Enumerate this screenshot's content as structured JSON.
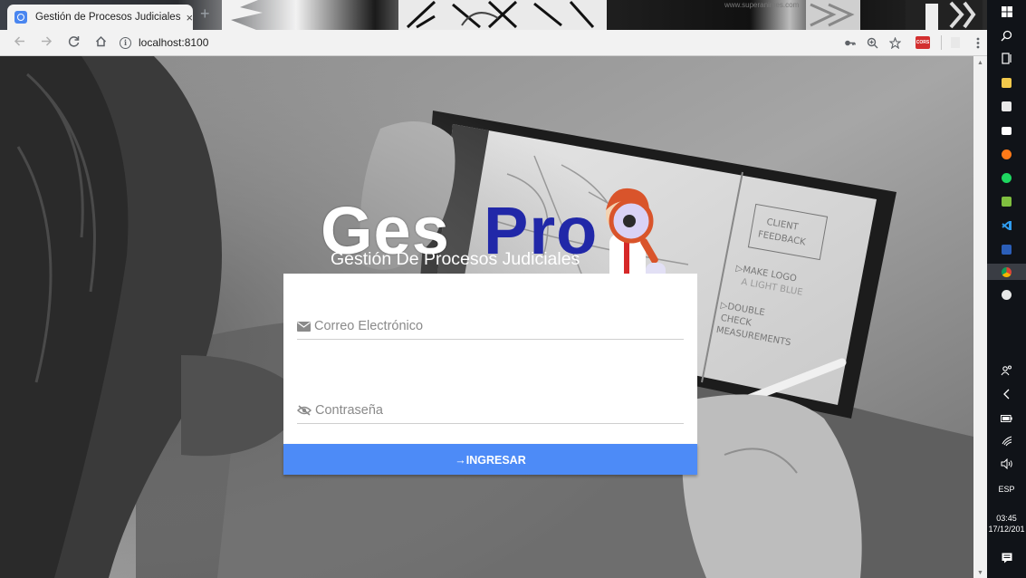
{
  "browser": {
    "tab_title": "Gestión de Procesos Judiciales",
    "tab_close": "×",
    "new_tab": "+",
    "watermark": "www.superanimes.com",
    "url": "localhost:8100",
    "back_icon": "arrow-left-icon",
    "forward_icon": "arrow-right-icon",
    "reload_icon": "reload-icon",
    "home_icon": "home-icon",
    "extension_label": "CORS"
  },
  "logo": {
    "part1": "Ges",
    "part2": "Pro",
    "subtitle": "Gestión De Procesos Judiciales",
    "colors": {
      "ges": "#ffffff",
      "pro": "#2128a8"
    }
  },
  "login": {
    "email_placeholder": "Correo Electrónico",
    "email_value": "",
    "email_icon": "envelope-icon",
    "password_placeholder": "Contraseña",
    "password_value": "",
    "password_icon": "eye-off-icon",
    "submit_label": "→INGRESAR",
    "accent": "#4d8bf7"
  },
  "taskbar": {
    "icons": [
      "windows-icon",
      "search-icon",
      "task-view-icon",
      "file-explorer-icon",
      "store-icon",
      "mail-icon",
      "firefox-icon",
      "spotify-icon",
      "sublime-icon",
      "vscode-icon",
      "word-icon",
      "chrome-icon",
      "emoji-icon"
    ],
    "language": "ESP",
    "time": "03:45",
    "date": "17/12/201"
  }
}
